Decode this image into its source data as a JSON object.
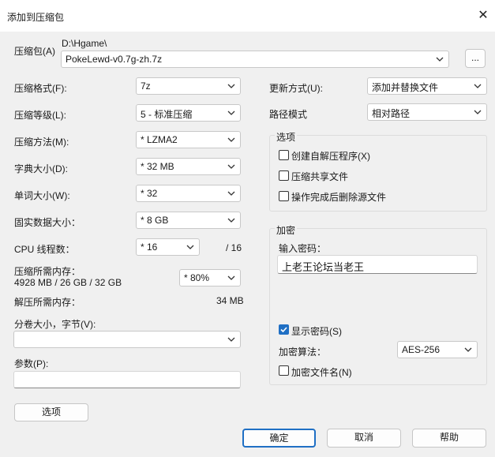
{
  "window": {
    "title": "添加到压缩包"
  },
  "archive": {
    "label": "压缩包(A)",
    "folder": "D:\\Hgame\\",
    "filename": "PokeLewd-v0.7g-zh.7z",
    "browse_label": "..."
  },
  "left": {
    "format": {
      "label": "压缩格式(F):",
      "value": "7z"
    },
    "level": {
      "label": "压缩等级(L):",
      "value": "5 - 标准压缩"
    },
    "method": {
      "label": "压缩方法(M):",
      "value": "* LZMA2"
    },
    "dict": {
      "label": "字典大小(D):",
      "value": "* 32 MB"
    },
    "word": {
      "label": "单词大小(W):",
      "value": "* 32"
    },
    "solid": {
      "label": "固实数据大小：",
      "value": "* 8 GB"
    },
    "threads": {
      "label": "CPU 线程数：",
      "value": "* 16",
      "total": "/ 16"
    },
    "mem_comp": {
      "label": "压缩所需内存：",
      "detail": "4928 MB / 26 GB / 32 GB",
      "value": "* 80%"
    },
    "mem_decomp": {
      "label": "解压所需内存：",
      "value": "34 MB"
    },
    "split": {
      "label": "分卷大小，字节(V):",
      "value": ""
    },
    "params": {
      "label": "参数(P):",
      "value": ""
    },
    "options_button": "选项"
  },
  "right": {
    "update": {
      "label": "更新方式(U):",
      "value": "添加并替换文件"
    },
    "pathmode": {
      "label": "路径模式",
      "value": "相对路径"
    },
    "options": {
      "title": "选项",
      "sfx": {
        "label": "创建自解压程序(X)",
        "checked": false
      },
      "shared": {
        "label": "压缩共享文件",
        "checked": false
      },
      "delete": {
        "label": "操作完成后删除源文件",
        "checked": false
      }
    },
    "encryption": {
      "title": "加密",
      "password_label": "输入密码：",
      "password_value": "上老王论坛当老王",
      "show_password": {
        "label": "显示密码(S)",
        "checked": true
      },
      "method_label": "加密算法：",
      "method_value": "AES-256",
      "encrypt_names": {
        "label": "加密文件名(N)",
        "checked": false
      }
    }
  },
  "footer": {
    "ok": "确定",
    "cancel": "取消",
    "help": "帮助"
  },
  "colors": {
    "accent": "#1f6fc4",
    "background": "#f0f0f0"
  }
}
